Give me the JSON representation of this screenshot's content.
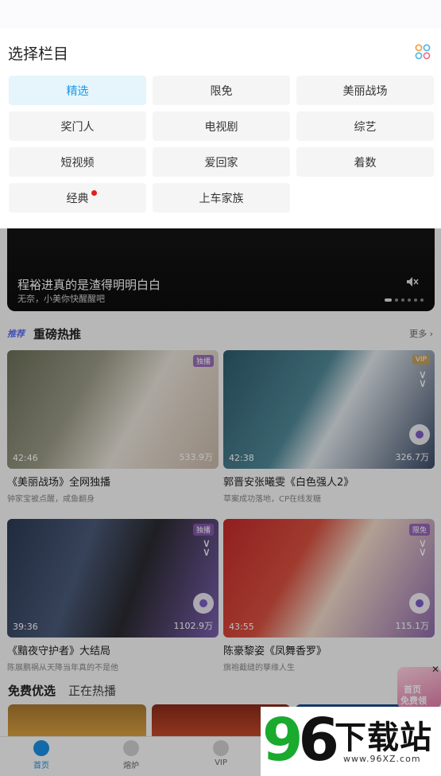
{
  "panel": {
    "title": "选择栏目",
    "channels": [
      {
        "label": "精选",
        "selected": true,
        "dot": false
      },
      {
        "label": "限免",
        "selected": false,
        "dot": false
      },
      {
        "label": "美丽战场",
        "selected": false,
        "dot": false
      },
      {
        "label": "奖门人",
        "selected": false,
        "dot": false
      },
      {
        "label": "电视剧",
        "selected": false,
        "dot": false
      },
      {
        "label": "综艺",
        "selected": false,
        "dot": false
      },
      {
        "label": "短视频",
        "selected": false,
        "dot": false
      },
      {
        "label": "爱回家",
        "selected": false,
        "dot": false
      },
      {
        "label": "着数",
        "selected": false,
        "dot": false
      },
      {
        "label": "经典",
        "selected": false,
        "dot": true
      },
      {
        "label": "上车家族",
        "selected": false,
        "dot": false
      }
    ],
    "accent_color": "#1a9be6",
    "grid_icon": "grid-apps-icon"
  },
  "banner": {
    "title": "程裕进真的是渣得明明白白",
    "subtitle": "无奈，小美你快醒醒吧",
    "mute_icon": "mute-icon"
  },
  "recommend": {
    "tag": "推荐",
    "title": "重磅热推",
    "more": "更多 ›",
    "cards": [
      {
        "duration": "42:46",
        "plays": "533.9万",
        "badge": "独播",
        "title": "《美丽战场》全网独播",
        "subtitle": "钟家宝被点醒，咸鱼翻身"
      },
      {
        "duration": "42:38",
        "plays": "326.7万",
        "badge": "VIP",
        "title": "郭晋安张曦雯《白色强人2》",
        "subtitle": "草案成功落地，CP在线发糖"
      },
      {
        "duration": "39:36",
        "plays": "1102.9万",
        "badge": "独播",
        "title": "《黯夜守护者》大结局",
        "subtitle": "陈展鹏祸从天降当年真的不是他"
      },
      {
        "duration": "43:55",
        "plays": "115.1万",
        "badge": "限免",
        "title": "陈豪黎姿《凤舞香罗》",
        "subtitle": "旗袍截缝的孳缘人生"
      }
    ]
  },
  "free_section": {
    "tab_active": "免费优选",
    "tab_inactive": "正在热播"
  },
  "float_ad": {
    "line1": "首页",
    "line2": "免费领"
  },
  "tabbar": {
    "items": [
      {
        "label": "首页",
        "icon": "home-icon",
        "active": true
      },
      {
        "label": "熔炉",
        "icon": "tv-icon",
        "active": false
      },
      {
        "label": "VIP",
        "icon": "vip-icon",
        "active": false
      }
    ]
  },
  "watermark": {
    "logo_number": "96",
    "logo_text": "下载站",
    "url": "www.96XZ.com"
  }
}
